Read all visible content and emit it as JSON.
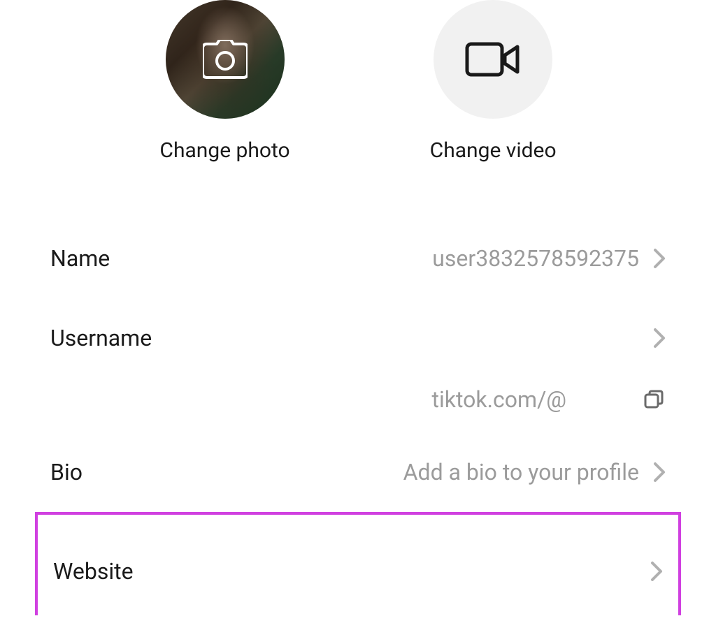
{
  "media": {
    "changePhotoLabel": "Change photo",
    "changeVideoLabel": "Change video"
  },
  "rows": {
    "name": {
      "label": "Name",
      "value": "user3832578592375"
    },
    "username": {
      "label": "Username",
      "value": ""
    },
    "profileLink": {
      "text": "tiktok.com/@"
    },
    "bio": {
      "label": "Bio",
      "placeholder": "Add a bio to your profile"
    },
    "website": {
      "label": "Website",
      "value": ""
    }
  }
}
